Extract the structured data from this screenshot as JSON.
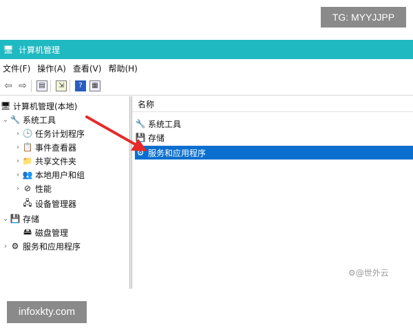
{
  "watermarks": {
    "top": "TG: MYYJJPP",
    "bottom": "infoxkty.com",
    "inline": "⚙@世外云"
  },
  "window": {
    "title": "计算机管理"
  },
  "menu": [
    "文件(F)",
    "操作(A)",
    "查看(V)",
    "帮助(H)"
  ],
  "tree": {
    "root": "计算机管理(本地)",
    "system_tools": "系统工具",
    "task_scheduler": "任务计划程序",
    "event_viewer": "事件查看器",
    "shared_folders": "共享文件夹",
    "local_users": "本地用户和组",
    "performance": "性能",
    "device_manager": "设备管理器",
    "storage": "存储",
    "disk_management": "磁盘管理",
    "services_apps": "服务和应用程序"
  },
  "list": {
    "column": "名称",
    "items": [
      "系统工具",
      "存储",
      "服务和应用程序"
    ],
    "selected_index": 2
  },
  "colors": {
    "titlebar": "#1fb9c2",
    "selection": "#0a6fcf",
    "arrow": "#e52a2a"
  }
}
